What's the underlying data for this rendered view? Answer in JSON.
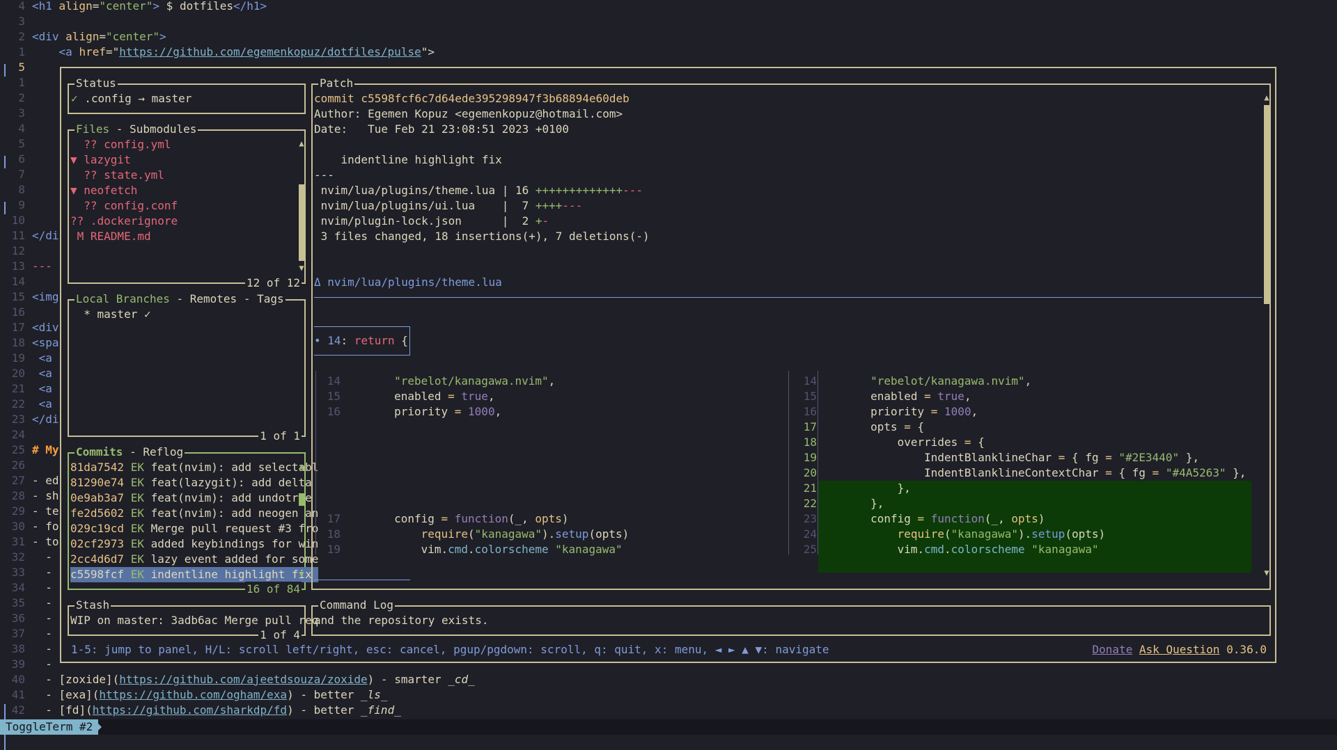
{
  "editor": {
    "lines": [
      {
        "num": "4",
        "segs": [
          [
            "tag",
            "<h1 "
          ],
          [
            "attr",
            "align"
          ],
          [
            "",
            "="
          ],
          [
            "str",
            "\"center\""
          ],
          [
            "tag",
            ">"
          ],
          [
            "",
            " $ dotfiles"
          ],
          [
            "tag",
            "</h1>"
          ]
        ]
      },
      {
        "num": "3",
        "segs": []
      },
      {
        "num": "2",
        "segs": [
          [
            "tag",
            "<div "
          ],
          [
            "attr",
            "align"
          ],
          [
            "",
            "="
          ],
          [
            "str",
            "\"center\""
          ],
          [
            "tag",
            ">"
          ]
        ]
      },
      {
        "num": "1",
        "segs": [
          [
            "",
            "    "
          ],
          [
            "tag",
            "<a "
          ],
          [
            "attr",
            "href"
          ],
          [
            "",
            "=\""
          ],
          [
            "url",
            "https://github.com/egemenkopuz/dotfiles/pulse"
          ],
          [
            "",
            "\">"
          ]
        ]
      },
      {
        "num": "5",
        "segs": [],
        "current": true
      }
    ],
    "left_lines": [
      {
        "num": "1",
        "text": ""
      },
      {
        "num": "2",
        "text": ""
      },
      {
        "num": "3",
        "text": ""
      },
      {
        "num": "4",
        "text": ""
      },
      {
        "num": "5",
        "text": ""
      },
      {
        "num": "6",
        "text": ""
      },
      {
        "num": "7",
        "text": ""
      },
      {
        "num": "8",
        "text": ""
      },
      {
        "num": "9",
        "text": ""
      },
      {
        "num": "10",
        "text": ""
      },
      {
        "num": "11",
        "text": "</di"
      },
      {
        "num": "12",
        "text": ""
      },
      {
        "num": "13",
        "text": "---"
      },
      {
        "num": "14",
        "text": ""
      },
      {
        "num": "15",
        "text": "<img"
      },
      {
        "num": "16",
        "text": ""
      },
      {
        "num": "17",
        "text": "<div"
      },
      {
        "num": "18",
        "text": "<spa"
      },
      {
        "num": "19",
        "text": " <a"
      },
      {
        "num": "20",
        "text": " <a"
      },
      {
        "num": "21",
        "text": " <a"
      },
      {
        "num": "22",
        "text": " <a"
      },
      {
        "num": "23",
        "text": "</di"
      },
      {
        "num": "24",
        "text": ""
      },
      {
        "num": "25",
        "text": "# My"
      },
      {
        "num": "26",
        "text": ""
      },
      {
        "num": "27",
        "text": "- ed"
      },
      {
        "num": "28",
        "text": "- sh"
      },
      {
        "num": "29",
        "text": "- te"
      },
      {
        "num": "30",
        "text": "- fo"
      },
      {
        "num": "31",
        "text": "- to"
      },
      {
        "num": "32",
        "text": "  -"
      },
      {
        "num": "33",
        "text": "  -"
      },
      {
        "num": "34",
        "text": "  -"
      },
      {
        "num": "35",
        "text": "  -"
      },
      {
        "num": "36",
        "text": "  -"
      },
      {
        "num": "37",
        "text": "  -"
      },
      {
        "num": "38",
        "text": "  -"
      },
      {
        "num": "39",
        "text": "  -"
      }
    ],
    "bottom_lines": [
      {
        "num": "40",
        "segs": [
          [
            "",
            "  - ["
          ],
          [
            "",
            "zoxide"
          ],
          [
            "",
            "]("
          ],
          [
            "url",
            "https://github.com/ajeetdsouza/zoxide"
          ],
          [
            "",
            ") - smarter "
          ],
          [
            "it",
            "_cd_"
          ]
        ]
      },
      {
        "num": "41",
        "segs": [
          [
            "",
            "  - ["
          ],
          [
            "",
            "exa"
          ],
          [
            "",
            "]("
          ],
          [
            "url",
            "https://github.com/ogham/exa"
          ],
          [
            "",
            ") - better "
          ],
          [
            "it",
            "_ls_"
          ]
        ]
      },
      {
        "num": "42",
        "segs": [
          [
            "",
            "  - ["
          ],
          [
            "",
            "fd"
          ],
          [
            "",
            "]("
          ],
          [
            "url",
            "https://github.com/sharkdp/fd"
          ],
          [
            "",
            ") - better "
          ],
          [
            "it",
            "_find_"
          ]
        ]
      }
    ]
  },
  "status_panel": {
    "title": "Status",
    "text": "✓ .config → master"
  },
  "files_panel": {
    "title": "Files",
    "title_rest": " - Submodules",
    "footer": "12 of 12",
    "items": [
      {
        "text": "  ?? config.yml",
        "color": "red"
      },
      {
        "text": "▼ lazygit",
        "color": "red"
      },
      {
        "text": "  ?? state.yml",
        "color": "red"
      },
      {
        "text": "▼ neofetch",
        "color": "red"
      },
      {
        "text": "  ?? config.conf",
        "color": "red"
      },
      {
        "text": "?? .dockerignore",
        "color": "red"
      },
      {
        "text": " M README.md",
        "color": "red"
      }
    ]
  },
  "branches_panel": {
    "title": "Local Branches",
    "title_rest": " - Remotes - Tags",
    "footer": "1 of 1",
    "items": [
      "  * master ✓"
    ]
  },
  "commits_panel": {
    "title": "Commits",
    "title_rest": " - Reflog",
    "footer": "16 of 84",
    "items": [
      {
        "hash": "81da7542",
        "author": "EK",
        "msg": "feat(nvim): add selectabl"
      },
      {
        "hash": "81290e74",
        "author": "EK",
        "msg": "feat(lazygit): add delta "
      },
      {
        "hash": "0e9ab3a7",
        "author": "EK",
        "msg": "feat(nvim): add undotree "
      },
      {
        "hash": "fe2d5602",
        "author": "EK",
        "msg": "feat(nvim): add neogen an"
      },
      {
        "hash": "029c19cd",
        "author": "EK",
        "msg": "Merge pull request #3 fro"
      },
      {
        "hash": "02cf2973",
        "author": "EK",
        "msg": "added keybindings for win"
      },
      {
        "hash": "2cc4d6d7",
        "author": "EK",
        "msg": "lazy event added for some"
      },
      {
        "hash": "c5598fcf",
        "author": "EK",
        "msg": "indentline highlight fix ",
        "selected": true
      }
    ]
  },
  "stash_panel": {
    "title": "Stash",
    "footer": "1 of 4",
    "text": "WIP on master: 3adb6ac Merge pull req"
  },
  "patch_panel": {
    "title": "Patch",
    "commit_line": "commit c5598fcf6c7d64ede395298947f3b68894e60deb",
    "author_line": "Author: Egemen Kopuz <egemenkopuz@hotmail.com>",
    "date_line": "Date:   Tue Feb 21 23:08:51 2023 +0100",
    "message": "    indentline highlight fix",
    "sep": "---",
    "stats": [
      {
        "file": " nvim/lua/plugins/theme.lua | 16 ",
        "plus": "+++++++++++++",
        "minus": "---"
      },
      {
        "file": " nvim/lua/plugins/ui.lua    |  7 ",
        "plus": "++++",
        "minus": "---"
      },
      {
        "file": " nvim/plugin-lock.json      |  2 ",
        "plus": "+",
        "minus": "-"
      }
    ],
    "summary": " 3 files changed, 18 insertions(+), 7 deletions(-)",
    "delta_file": "Δ nvim/lua/plugins/theme.lua",
    "hunk_dot": "•",
    "hunk_num": "14",
    "hunk_colon": ": ",
    "hunk_kw": "return",
    "hunk_rest": " {",
    "left": [
      {
        "n": "14",
        "segs": [
          [
            "",
            "        "
          ],
          [
            "str",
            "\"rebelot/kanagawa.nvim\""
          ],
          [
            "",
            ","
          ]
        ]
      },
      {
        "n": "15",
        "segs": [
          [
            "",
            "        enabled "
          ],
          [
            "yel",
            "="
          ],
          [
            "",
            ""
          ],
          [
            "pur",
            " true"
          ],
          [
            "",
            ","
          ]
        ]
      },
      {
        "n": "16",
        "segs": [
          [
            "",
            "        priority "
          ],
          [
            "yel",
            "="
          ],
          [
            "pur",
            " 1000"
          ],
          [
            "",
            ","
          ]
        ]
      },
      {
        "n": "",
        "segs": []
      },
      {
        "n": "",
        "segs": []
      },
      {
        "n": "",
        "segs": []
      },
      {
        "n": "",
        "segs": []
      },
      {
        "n": "",
        "segs": []
      },
      {
        "n": "",
        "segs": []
      },
      {
        "n": "17",
        "segs": [
          [
            "",
            "        config "
          ],
          [
            "yel",
            "="
          ],
          [
            "pur",
            " function"
          ],
          [
            "",
            "("
          ],
          [
            "",
            ""
          ],
          [
            "",
            "_, "
          ],
          [
            "yel",
            "opts"
          ],
          [
            "",
            ")"
          ]
        ]
      },
      {
        "n": "18",
        "segs": [
          [
            "",
            "            "
          ],
          [
            "yel",
            "require"
          ],
          [
            "",
            "("
          ],
          [
            "str",
            "\"kanagawa\""
          ],
          [
            "",
            ")."
          ],
          [
            "blu",
            "setup"
          ],
          [
            "",
            "(opts)"
          ]
        ]
      },
      {
        "n": "19",
        "segs": [
          [
            "",
            "            vim."
          ],
          [
            "cyn",
            "cmd"
          ],
          [
            "",
            "."
          ],
          [
            "cyn",
            "colorscheme"
          ],
          [
            "",
            " "
          ],
          [
            "str",
            "\"kanagawa\""
          ]
        ]
      }
    ],
    "right": [
      {
        "n": "14",
        "segs": [
          [
            "",
            "        "
          ],
          [
            "str",
            "\"rebelot/kanagawa.nvim\""
          ],
          [
            "",
            ","
          ]
        ]
      },
      {
        "n": "15",
        "segs": [
          [
            "",
            "        enabled "
          ],
          [
            "yel",
            "="
          ],
          [
            "pur",
            " true"
          ],
          [
            "",
            ","
          ]
        ]
      },
      {
        "n": "16",
        "segs": [
          [
            "",
            "        priority "
          ],
          [
            "yel",
            "="
          ],
          [
            "pur",
            " 1000"
          ],
          [
            "",
            ","
          ]
        ]
      },
      {
        "n": "17",
        "add": true,
        "segs": [
          [
            "",
            "        opts "
          ],
          [
            "yel",
            "="
          ],
          [
            "",
            " {"
          ]
        ]
      },
      {
        "n": "18",
        "add": true,
        "segs": [
          [
            "",
            "            overrides "
          ],
          [
            "yel",
            "="
          ],
          [
            "",
            " {"
          ]
        ]
      },
      {
        "n": "19",
        "add": true,
        "segs": [
          [
            "",
            "                IndentBlanklineChar "
          ],
          [
            "yel",
            "="
          ],
          [
            "",
            " { fg "
          ],
          [
            "yel",
            "="
          ],
          [
            "",
            " "
          ],
          [
            "str",
            "\"#2E3440\""
          ],
          [
            "",
            " },"
          ]
        ]
      },
      {
        "n": "20",
        "add": true,
        "segs": [
          [
            "",
            "                IndentBlanklineContextChar "
          ],
          [
            "yel",
            "="
          ],
          [
            "",
            " { fg "
          ],
          [
            "yel",
            "="
          ],
          [
            "",
            " "
          ],
          [
            "str",
            "\"#4A5263\""
          ],
          [
            "",
            " },"
          ]
        ]
      },
      {
        "n": "21",
        "add": true,
        "segs": [
          [
            "",
            "            },"
          ]
        ]
      },
      {
        "n": "22",
        "add": true,
        "segs": [
          [
            "",
            "        },"
          ]
        ]
      },
      {
        "n": "23",
        "segs": [
          [
            "",
            "        config "
          ],
          [
            "yel",
            "="
          ],
          [
            "pur",
            " function"
          ],
          [
            "",
            "(_, "
          ],
          [
            "yel",
            "opts"
          ],
          [
            "",
            ")"
          ]
        ]
      },
      {
        "n": "24",
        "segs": [
          [
            "",
            "            "
          ],
          [
            "yel",
            "require"
          ],
          [
            "",
            "("
          ],
          [
            "str",
            "\"kanagawa\""
          ],
          [
            "",
            ")."
          ],
          [
            "blu",
            "setup"
          ],
          [
            "",
            "(opts)"
          ]
        ]
      },
      {
        "n": "25",
        "segs": [
          [
            "",
            "            vim."
          ],
          [
            "cyn",
            "cmd"
          ],
          [
            "",
            "."
          ],
          [
            "cyn",
            "colorscheme"
          ],
          [
            "",
            " "
          ],
          [
            "str",
            "\"kanagawa\""
          ]
        ]
      }
    ]
  },
  "command_log": {
    "title": "Command Log",
    "text": "and the repository exists."
  },
  "hint_bar": "1-5: jump to panel, H/L: scroll left/right, esc: cancel, pgup/pgdown: scroll, q: quit, x: menu, ◄ ► ▲ ▼: navigate",
  "donate": "Donate",
  "ask": "Ask Question",
  "version": "0.36.0",
  "terminal_name": "ToggleTerm #2",
  "colors": {
    "border": "#c8c093",
    "background": "#1f1f28",
    "added": "#0c3b08",
    "selected": "#5873a3"
  }
}
